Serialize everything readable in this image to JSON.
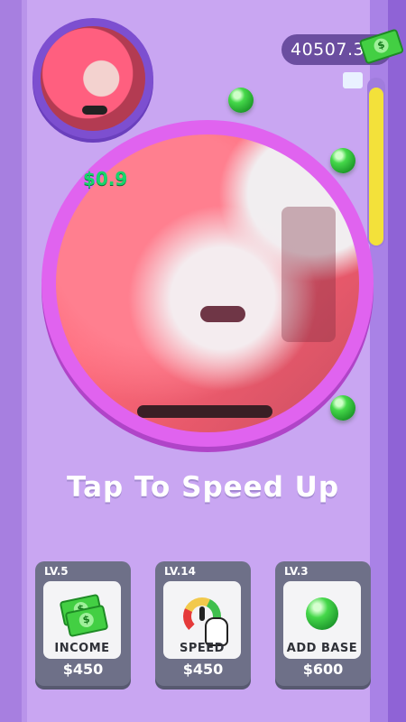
{
  "currency": {
    "balance": "40507.3",
    "money_icon": "cash-icon",
    "coin_symbol": "$"
  },
  "progress": {
    "fill_fraction": 0.95
  },
  "arena": {
    "earn_popup": "$0.9"
  },
  "prompt": {
    "text": "Tap To Speed Up"
  },
  "upgrades": [
    {
      "level": "LV.5",
      "name": "INCOME",
      "price": "$450",
      "icon": "cash-stack-icon"
    },
    {
      "level": "LV.14",
      "name": "SPEED",
      "price": "$450",
      "icon": "speed-gauge-icon"
    },
    {
      "level": "LV.3",
      "name": "ADD BASE",
      "price": "$600",
      "icon": "green-ball-icon"
    }
  ],
  "colors": {
    "background": "#c9a6f2",
    "arena_ring": "#e063ef",
    "ball_green": "#45d84a",
    "progress_yellow": "#f3e13a",
    "card": "#6e7088"
  }
}
